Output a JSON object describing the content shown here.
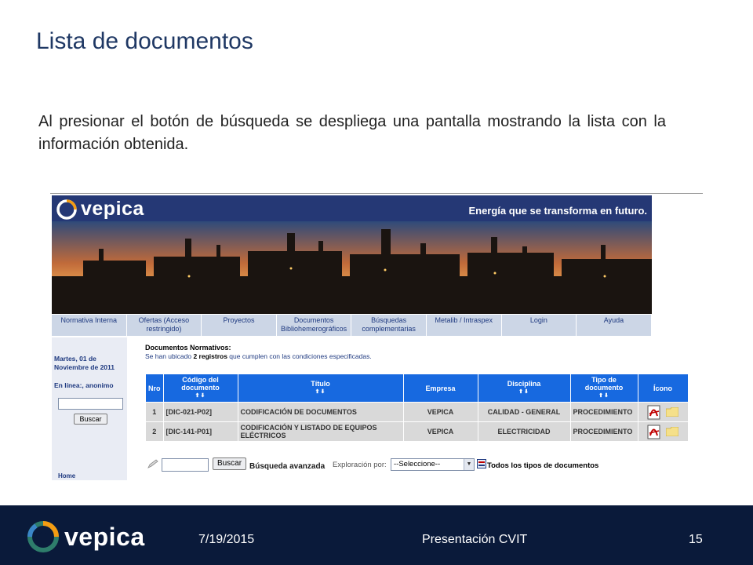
{
  "slide": {
    "title": "Lista de documentos",
    "body": "Al presionar el botón de búsqueda se despliega una pantalla mostrando la lista con la información obtenida."
  },
  "site": {
    "logo_text": "vepica",
    "tagline": "Energía que se transforma en futuro.",
    "nav": [
      {
        "label": "Normativa Interna"
      },
      {
        "label": "Ofertas (Acceso restringido)"
      },
      {
        "label": "Proyectos"
      },
      {
        "label": "Documentos Bibliohemerográficos"
      },
      {
        "label": "Búsquedas complementarias"
      },
      {
        "label": "Metalib / Intraspex"
      },
      {
        "label": "Login"
      },
      {
        "label": "Ayuda"
      }
    ],
    "sidebar": {
      "date": "Martes, 01 de Noviembre de 2011",
      "online": "En línea:, anonimo",
      "search_button": "Buscar",
      "home": "Home"
    },
    "results": {
      "title": "Documentos Normativos:",
      "count_prefix": "Se han ubicado ",
      "count_value": "2 registros",
      "count_suffix": " que cumplen con las condiciones especificadas.",
      "headers": {
        "nro": "Nro",
        "codigo": "Código del documento",
        "titulo": "Título",
        "empresa": "Empresa",
        "disciplina": "Disciplina",
        "tipo": "Tipo de documento",
        "icono": "Ícono"
      },
      "sort_arrows": "⬆⬇",
      "rows": [
        {
          "nro": "1",
          "codigo": "[DIC-021-P02]",
          "titulo": "CODIFICACIÓN DE DOCUMENTOS",
          "empresa": "VEPICA",
          "disciplina": "CALIDAD - GENERAL",
          "tipo": "PROCEDIMIENTO"
        },
        {
          "nro": "2",
          "codigo": "[DIC-141-P01]",
          "titulo": "CODIFICACIÓN Y LISTADO DE EQUIPOS ELÉCTRICOS",
          "empresa": "VEPICA",
          "disciplina": "ELECTRICIDAD",
          "tipo": "PROCEDIMIENTO"
        }
      ]
    },
    "searchbar": {
      "button": "Buscar",
      "advanced": "Búsqueda avanzada",
      "explore_label": "Exploración por:",
      "select_value": "--Seleccione--",
      "all_types": "Todos los tipos de documentos"
    }
  },
  "footer": {
    "logo_text": "vepica",
    "date": "7/19/2015",
    "center": "Presentación CVIT",
    "page": "15"
  },
  "colors": {
    "title": "#1f3864",
    "banner": "#253875",
    "nav_bg": "#ccd6e6",
    "table_header": "#1769e0",
    "table_cell": "#d9d9d9",
    "footer_bg": "#0a1a3a"
  },
  "icons": [
    "vepica-logo-icon",
    "pdf-icon",
    "folder-icon",
    "pencil-icon",
    "document-types-icon"
  ]
}
